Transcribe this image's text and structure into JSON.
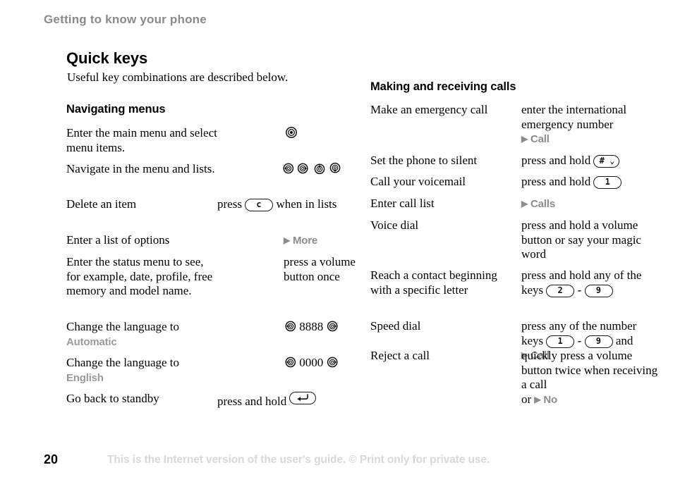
{
  "page": {
    "running_header": "Getting to know your phone",
    "chapter_title": "Quick keys",
    "chapter_intro": "Useful key combinations are described below.",
    "page_number": "20",
    "footer_note": "This is the Internet version of the user's guide. © Print only for private use.",
    "colors": {
      "running_header": "#8a8a8a",
      "ui_label_grey": "#9a9a9a",
      "marker_grey": "#8c8c8c",
      "footer_grey": "#d8d8d8",
      "text_black": "#000000"
    }
  },
  "left_column": {
    "heading": "Navigating menus",
    "rows": [
      {
        "term": "Enter the main menu and select menu items.",
        "def_text": ""
      },
      {
        "term": "Navigate in the menu and lists.",
        "def_text": ""
      },
      {
        "term": "Delete an item",
        "def_pre": "press",
        "key": "c",
        "def_post": "when in lists"
      },
      {
        "term": "Enter a list of options",
        "marker": "More",
        "marker_arrow": "▶"
      },
      {
        "term": "Enter the status menu to see, for example, date, profile, free memory and model name.",
        "def_text": "press a volume button once"
      },
      {
        "term": "Change the language to",
        "term_label": "Automatic",
        "digits": "8888"
      },
      {
        "term": "Change the language to",
        "term_label": "English",
        "digits": "0000"
      },
      {
        "term": "Go back to standby",
        "def_pre": "press and hold",
        "key": "back-arrow"
      }
    ]
  },
  "right_column": {
    "heading": "Making and receiving calls",
    "rows": [
      {
        "term": "Make an emergency call",
        "def_text": "enter the international emergency number",
        "marker": "Call",
        "marker_arrow": "▶"
      },
      {
        "term": "Set the phone to silent",
        "def_pre": "press and hold",
        "key": "# ⌄"
      },
      {
        "term": "Call your voicemail",
        "def_pre": "press and hold",
        "key": "1"
      },
      {
        "term": "Enter call list",
        "marker": "Calls",
        "marker_arrow": "▶"
      },
      {
        "term": "Voice dial",
        "def_text": "press and hold a volume button or say your magic word"
      },
      {
        "term": "Reach a contact beginning with a specific letter",
        "def_pre": "press and hold any of the keys",
        "key_from": "2",
        "key_sep": "-",
        "key_to": "9"
      },
      {
        "term": "Speed dial",
        "def_pre": "press any of the number keys",
        "key_from": "1",
        "key_sep": "-",
        "key_to": "9",
        "def_mid": "and",
        "marker": "Call",
        "marker_arrow": "▶"
      },
      {
        "term": "Reject a call",
        "def_text": "quickly press a volume button twice when receiving a call",
        "def_or": "or",
        "marker": "No",
        "marker_arrow": "▶"
      }
    ]
  },
  "icons": {
    "select_key": "nav-select-key-icon",
    "left_key": "nav-left-key-icon",
    "right_key": "nav-right-key-icon",
    "up_key": "nav-up-key-icon",
    "down_key": "nav-down-key-icon",
    "back_key": "back-key-icon"
  }
}
